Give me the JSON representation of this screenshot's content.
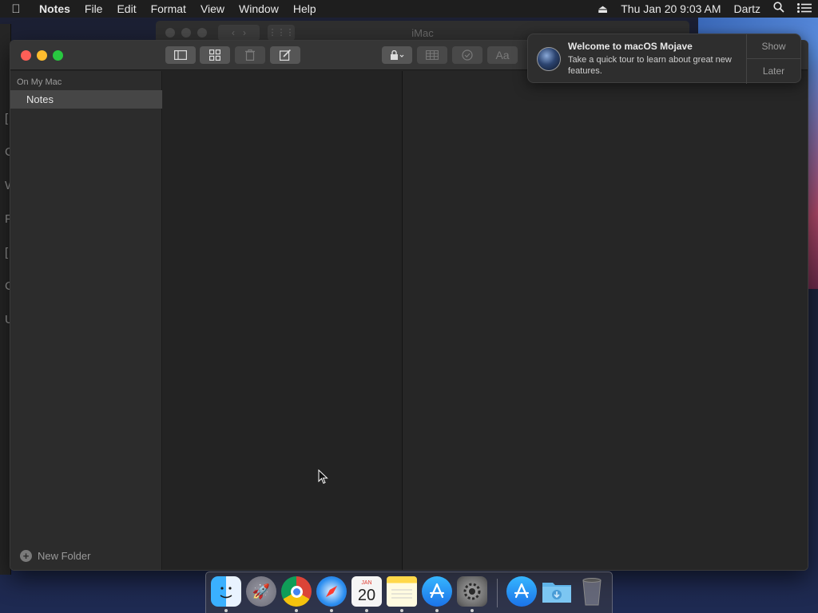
{
  "menubar": {
    "app_name": "Notes",
    "menus": [
      "File",
      "Edit",
      "Format",
      "View",
      "Window",
      "Help"
    ],
    "status": {
      "datetime": "Thu Jan 20  9:03 AM",
      "user": "Dartz"
    }
  },
  "background_window": {
    "title": "iMac",
    "left_edge_letters": [
      "[",
      "C",
      "W",
      "F",
      "[",
      "C",
      "U"
    ]
  },
  "sidebar": {
    "section_label": "On My Mac",
    "folders": [
      {
        "label": "Notes",
        "selected": true
      }
    ],
    "new_folder_label": "New Folder"
  },
  "toolbar": {
    "icons": [
      "sidebar-toggle-icon",
      "gallery-view-icon",
      "trash-icon",
      "compose-icon",
      "lock-icon",
      "table-icon",
      "checklist-icon",
      "format-text-icon"
    ],
    "format_text_label": "Aa"
  },
  "notification": {
    "title": "Welcome to macOS Mojave",
    "body": "Take a quick tour to learn about great new features.",
    "show_label": "Show",
    "later_label": "Later"
  },
  "dock": {
    "apps": [
      "Finder",
      "Launchpad",
      "Google Chrome",
      "Safari",
      "Calendar",
      "Notes",
      "App Store",
      "System Preferences",
      "App Store Downloads",
      "Downloads",
      "Trash"
    ],
    "calendar_month": "JAN",
    "calendar_day": "20"
  },
  "colors": {
    "close": "#fe5f57",
    "minimize": "#febc2e",
    "maximize": "#28c840",
    "sidebar_selected": "#464646"
  }
}
